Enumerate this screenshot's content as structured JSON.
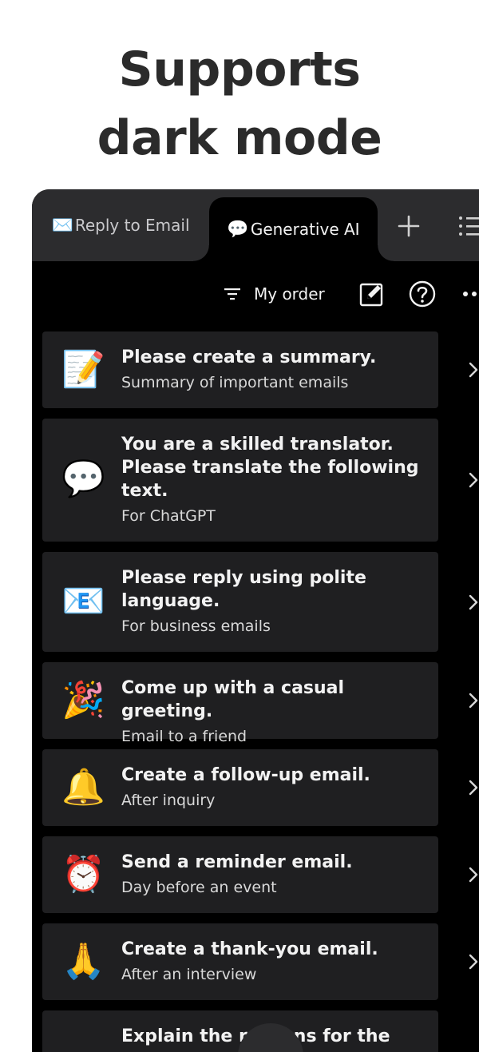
{
  "headline": {
    "line1": "Supports",
    "line2": "dark mode"
  },
  "tabs": {
    "email": {
      "emoji": "✉️",
      "label": "Reply to Email"
    },
    "ai": {
      "emoji": "💬",
      "label": "Generative AI"
    }
  },
  "toolbar": {
    "sort_label": "My order"
  },
  "colors": {
    "background": "#000000",
    "card": "#1f1f21",
    "tabbar": "#2c2c2e",
    "text": "#f2f2f2"
  },
  "prompts": [
    {
      "emoji": "📝",
      "title": "Please create a summary.",
      "subtitle": "Summary of important emails"
    },
    {
      "emoji": "💬",
      "title": "You are a skilled translator. Please translate the following text.",
      "subtitle": "For ChatGPT"
    },
    {
      "emoji": "📧",
      "title": "Please reply using polite language.",
      "subtitle": "For business emails"
    },
    {
      "emoji": "🎉",
      "title": "Come up with a casual greeting.",
      "subtitle": "Email to a friend"
    },
    {
      "emoji": "🔔",
      "title": "Create a follow-up email.",
      "subtitle": "After inquiry"
    },
    {
      "emoji": "⏰",
      "title": "Send a reminder email.",
      "subtitle": "Day before an event"
    },
    {
      "emoji": "🙏",
      "title": "Create a thank-you email.",
      "subtitle": "After an interview"
    },
    {
      "emoji": "",
      "title": "Explain the reasons for the",
      "subtitle": ""
    }
  ]
}
